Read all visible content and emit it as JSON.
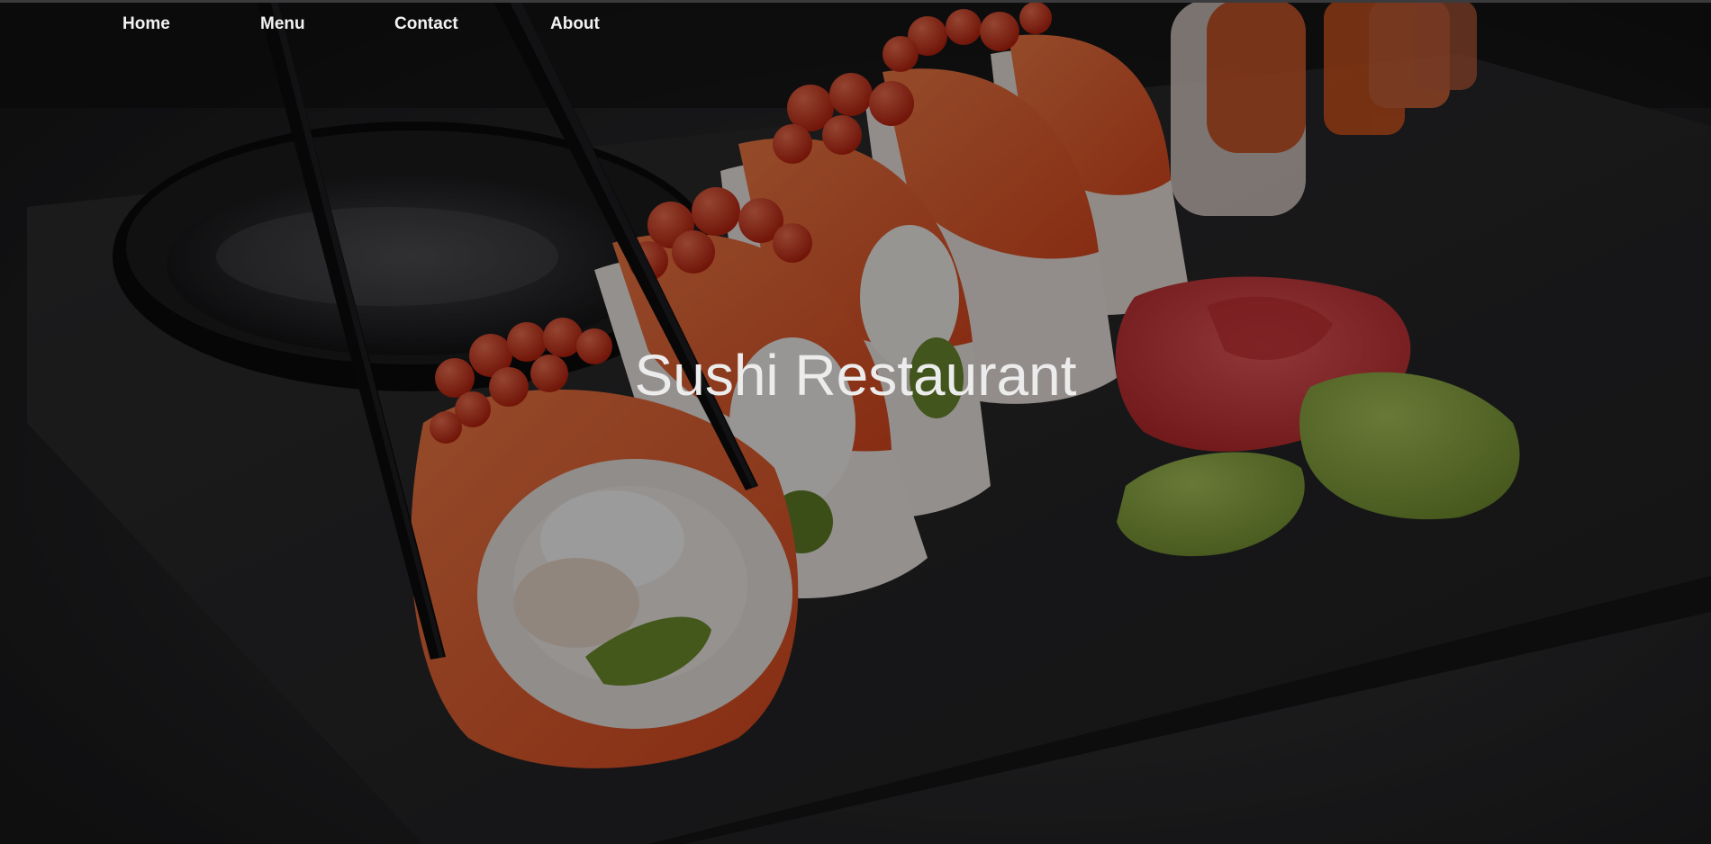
{
  "nav": {
    "home_label": "Home",
    "menu_label": "Menu",
    "contact_label": "Contact",
    "about_label": "About"
  },
  "hero": {
    "title": "Sushi Restaurant"
  },
  "colors": {
    "nav_text": "#f2f2f2",
    "title_text": "#ececec",
    "salmon": "#e8562b",
    "roe": "#d8381c",
    "rice": "#ece6e2",
    "wasabi": "#86a63a",
    "ginger": "#d93a3c",
    "slate": "#2b2b2d",
    "chopstick": "#0d0d0f"
  },
  "icons": {
    "background": "sushi-photo"
  }
}
